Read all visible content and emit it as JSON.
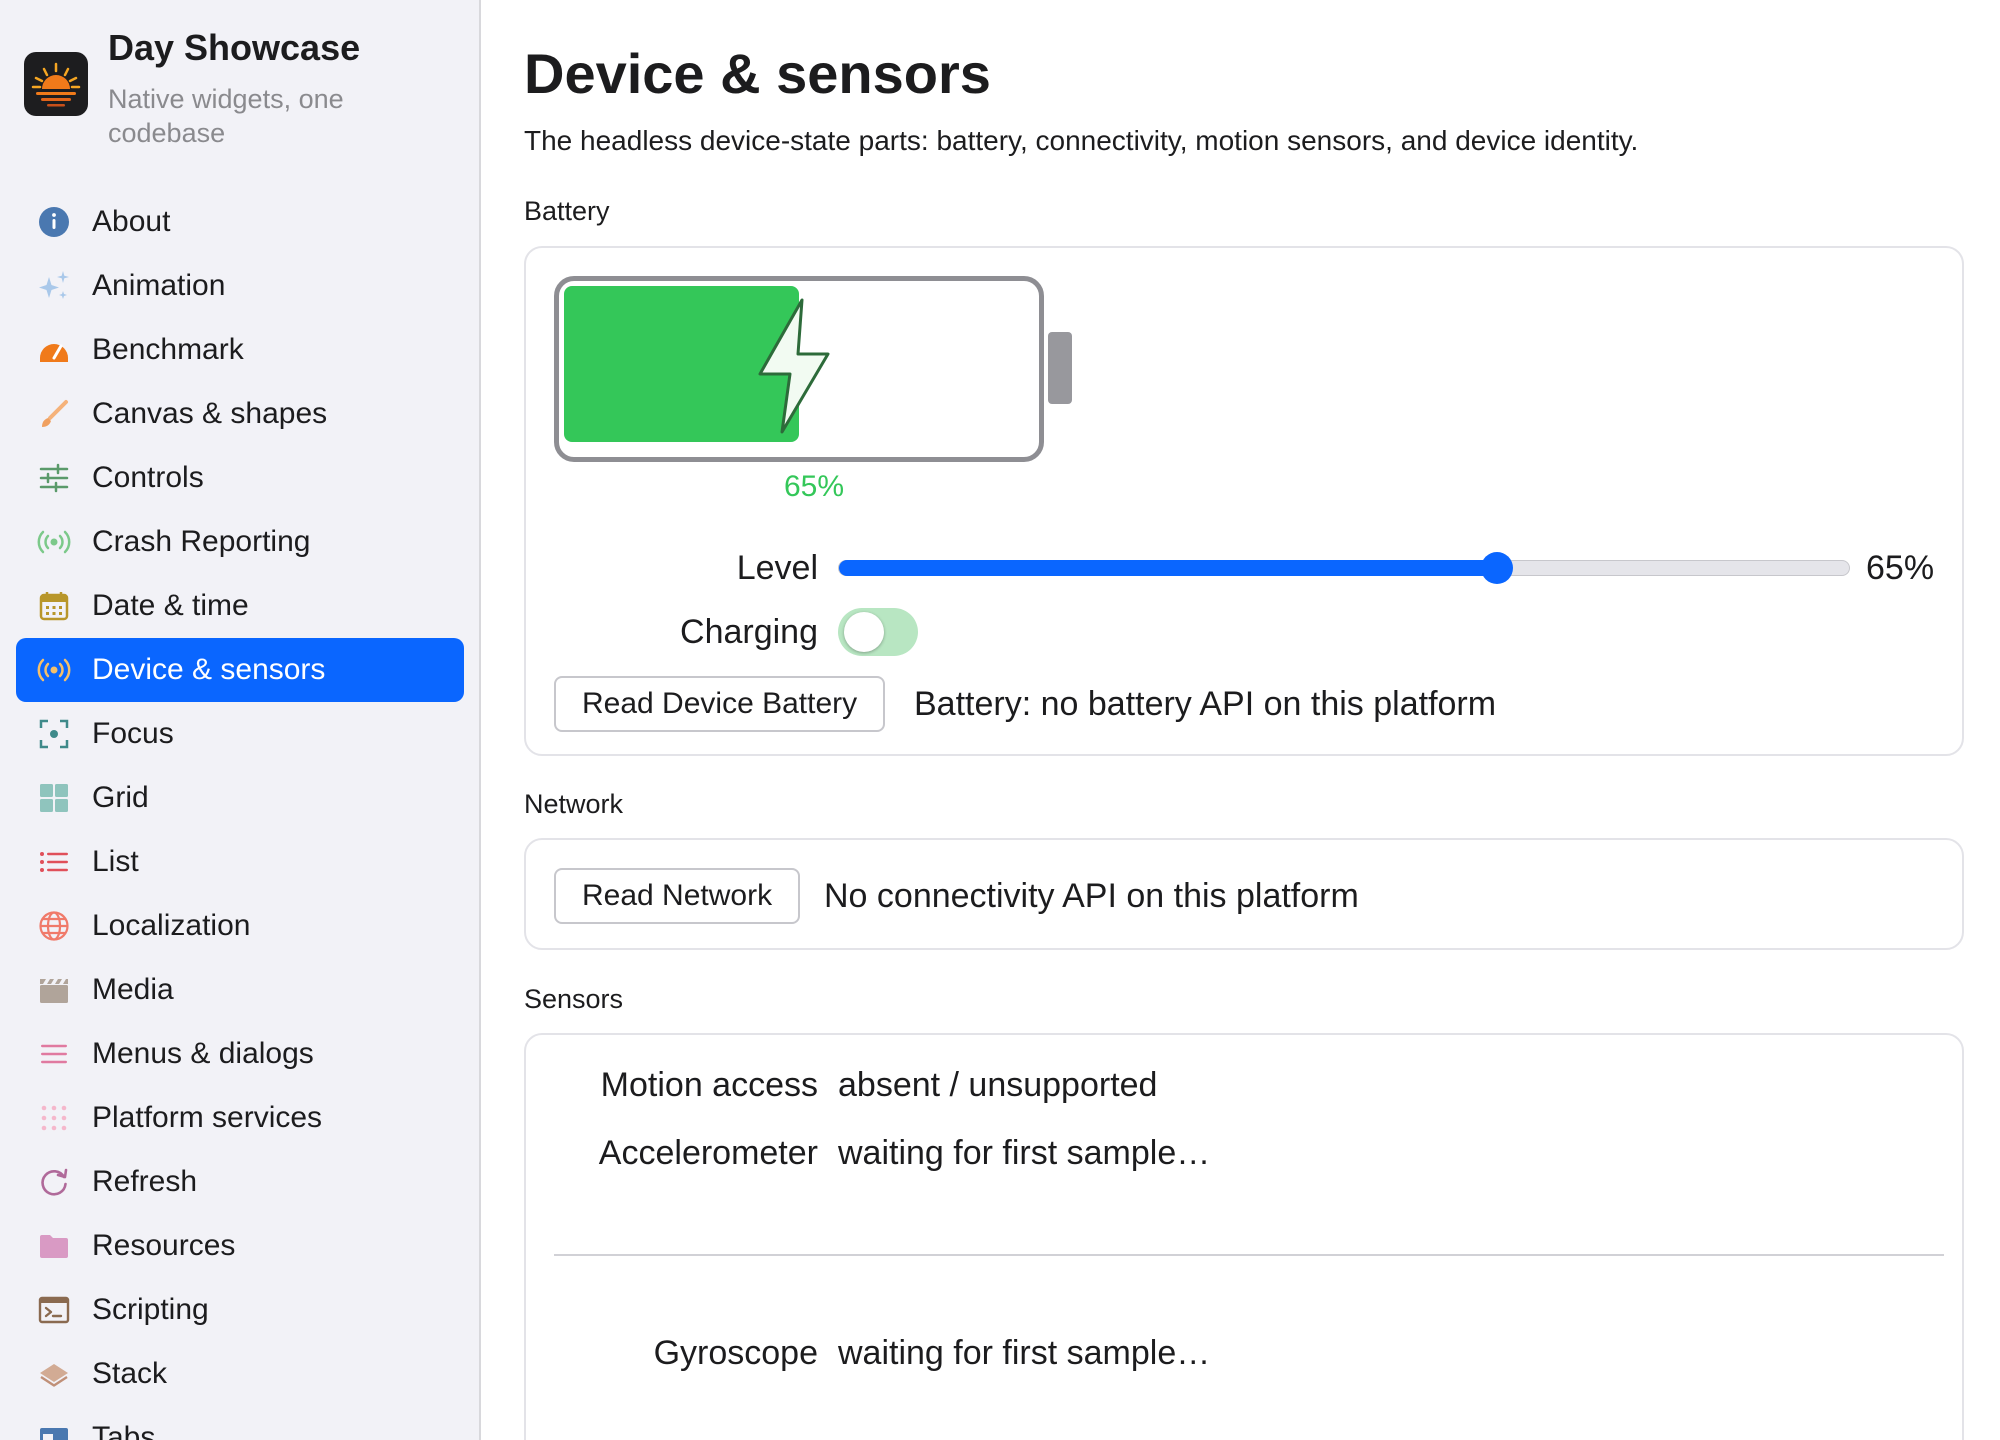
{
  "app": {
    "title": "Day Showcase",
    "subtitle": "Native widgets, one codebase"
  },
  "sidebar": {
    "items": [
      {
        "label": "About",
        "icon": "info-icon"
      },
      {
        "label": "Animation",
        "icon": "sparkles-icon"
      },
      {
        "label": "Benchmark",
        "icon": "gauge-icon"
      },
      {
        "label": "Canvas & shapes",
        "icon": "paintbrush-icon"
      },
      {
        "label": "Controls",
        "icon": "sliders-icon"
      },
      {
        "label": "Crash Reporting",
        "icon": "broadcast-icon"
      },
      {
        "label": "Date & time",
        "icon": "calendar-icon"
      },
      {
        "label": "Device & sensors",
        "icon": "broadcast-icon",
        "active": true
      },
      {
        "label": "Focus",
        "icon": "focus-icon"
      },
      {
        "label": "Grid",
        "icon": "grid-icon"
      },
      {
        "label": "List",
        "icon": "list-icon"
      },
      {
        "label": "Localization",
        "icon": "globe-icon"
      },
      {
        "label": "Media",
        "icon": "clapperboard-icon"
      },
      {
        "label": "Menus & dialogs",
        "icon": "menu-icon"
      },
      {
        "label": "Platform services",
        "icon": "dots-grid-icon"
      },
      {
        "label": "Refresh",
        "icon": "refresh-icon"
      },
      {
        "label": "Resources",
        "icon": "folder-icon"
      },
      {
        "label": "Scripting",
        "icon": "terminal-icon"
      },
      {
        "label": "Stack",
        "icon": "stack-icon"
      },
      {
        "label": "Tabs",
        "icon": "tabs-icon"
      }
    ]
  },
  "page": {
    "title": "Device & sensors",
    "description": "The headless device-state parts: battery, connectivity, motion sensors, and device identity."
  },
  "battery": {
    "section_label": "Battery",
    "level_fraction": 0.65,
    "percent_text": "65%",
    "level_label": "Level",
    "level_value_text": "65%",
    "charging_label": "Charging",
    "charging_on": true,
    "read_button": "Read Device Battery",
    "status": "Battery: no battery API on this platform"
  },
  "network": {
    "section_label": "Network",
    "read_button": "Read Network",
    "status": "No connectivity API on this platform"
  },
  "sensors": {
    "section_label": "Sensors",
    "motion_access_label": "Motion access",
    "motion_access_value": "absent / unsupported",
    "accelerometer_label": "Accelerometer",
    "accelerometer_value": "waiting for first sample…",
    "gyroscope_label": "Gyroscope",
    "gyroscope_value": "waiting for first sample…"
  },
  "colors": {
    "accent": "#0a66ff",
    "battery_green": "#34c759",
    "sidebar_bg": "#f2f2f7"
  }
}
